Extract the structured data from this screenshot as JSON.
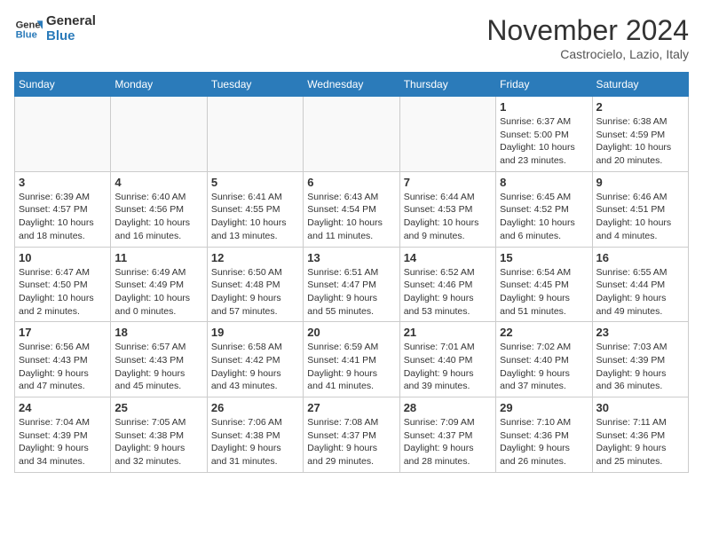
{
  "header": {
    "logo_line1": "General",
    "logo_line2": "Blue",
    "month": "November 2024",
    "location": "Castrocielo, Lazio, Italy"
  },
  "weekdays": [
    "Sunday",
    "Monday",
    "Tuesday",
    "Wednesday",
    "Thursday",
    "Friday",
    "Saturday"
  ],
  "weeks": [
    [
      {
        "day": "",
        "info": ""
      },
      {
        "day": "",
        "info": ""
      },
      {
        "day": "",
        "info": ""
      },
      {
        "day": "",
        "info": ""
      },
      {
        "day": "",
        "info": ""
      },
      {
        "day": "1",
        "info": "Sunrise: 6:37 AM\nSunset: 5:00 PM\nDaylight: 10 hours\nand 23 minutes."
      },
      {
        "day": "2",
        "info": "Sunrise: 6:38 AM\nSunset: 4:59 PM\nDaylight: 10 hours\nand 20 minutes."
      }
    ],
    [
      {
        "day": "3",
        "info": "Sunrise: 6:39 AM\nSunset: 4:57 PM\nDaylight: 10 hours\nand 18 minutes."
      },
      {
        "day": "4",
        "info": "Sunrise: 6:40 AM\nSunset: 4:56 PM\nDaylight: 10 hours\nand 16 minutes."
      },
      {
        "day": "5",
        "info": "Sunrise: 6:41 AM\nSunset: 4:55 PM\nDaylight: 10 hours\nand 13 minutes."
      },
      {
        "day": "6",
        "info": "Sunrise: 6:43 AM\nSunset: 4:54 PM\nDaylight: 10 hours\nand 11 minutes."
      },
      {
        "day": "7",
        "info": "Sunrise: 6:44 AM\nSunset: 4:53 PM\nDaylight: 10 hours\nand 9 minutes."
      },
      {
        "day": "8",
        "info": "Sunrise: 6:45 AM\nSunset: 4:52 PM\nDaylight: 10 hours\nand 6 minutes."
      },
      {
        "day": "9",
        "info": "Sunrise: 6:46 AM\nSunset: 4:51 PM\nDaylight: 10 hours\nand 4 minutes."
      }
    ],
    [
      {
        "day": "10",
        "info": "Sunrise: 6:47 AM\nSunset: 4:50 PM\nDaylight: 10 hours\nand 2 minutes."
      },
      {
        "day": "11",
        "info": "Sunrise: 6:49 AM\nSunset: 4:49 PM\nDaylight: 10 hours\nand 0 minutes."
      },
      {
        "day": "12",
        "info": "Sunrise: 6:50 AM\nSunset: 4:48 PM\nDaylight: 9 hours\nand 57 minutes."
      },
      {
        "day": "13",
        "info": "Sunrise: 6:51 AM\nSunset: 4:47 PM\nDaylight: 9 hours\nand 55 minutes."
      },
      {
        "day": "14",
        "info": "Sunrise: 6:52 AM\nSunset: 4:46 PM\nDaylight: 9 hours\nand 53 minutes."
      },
      {
        "day": "15",
        "info": "Sunrise: 6:54 AM\nSunset: 4:45 PM\nDaylight: 9 hours\nand 51 minutes."
      },
      {
        "day": "16",
        "info": "Sunrise: 6:55 AM\nSunset: 4:44 PM\nDaylight: 9 hours\nand 49 minutes."
      }
    ],
    [
      {
        "day": "17",
        "info": "Sunrise: 6:56 AM\nSunset: 4:43 PM\nDaylight: 9 hours\nand 47 minutes."
      },
      {
        "day": "18",
        "info": "Sunrise: 6:57 AM\nSunset: 4:43 PM\nDaylight: 9 hours\nand 45 minutes."
      },
      {
        "day": "19",
        "info": "Sunrise: 6:58 AM\nSunset: 4:42 PM\nDaylight: 9 hours\nand 43 minutes."
      },
      {
        "day": "20",
        "info": "Sunrise: 6:59 AM\nSunset: 4:41 PM\nDaylight: 9 hours\nand 41 minutes."
      },
      {
        "day": "21",
        "info": "Sunrise: 7:01 AM\nSunset: 4:40 PM\nDaylight: 9 hours\nand 39 minutes."
      },
      {
        "day": "22",
        "info": "Sunrise: 7:02 AM\nSunset: 4:40 PM\nDaylight: 9 hours\nand 37 minutes."
      },
      {
        "day": "23",
        "info": "Sunrise: 7:03 AM\nSunset: 4:39 PM\nDaylight: 9 hours\nand 36 minutes."
      }
    ],
    [
      {
        "day": "24",
        "info": "Sunrise: 7:04 AM\nSunset: 4:39 PM\nDaylight: 9 hours\nand 34 minutes."
      },
      {
        "day": "25",
        "info": "Sunrise: 7:05 AM\nSunset: 4:38 PM\nDaylight: 9 hours\nand 32 minutes."
      },
      {
        "day": "26",
        "info": "Sunrise: 7:06 AM\nSunset: 4:38 PM\nDaylight: 9 hours\nand 31 minutes."
      },
      {
        "day": "27",
        "info": "Sunrise: 7:08 AM\nSunset: 4:37 PM\nDaylight: 9 hours\nand 29 minutes."
      },
      {
        "day": "28",
        "info": "Sunrise: 7:09 AM\nSunset: 4:37 PM\nDaylight: 9 hours\nand 28 minutes."
      },
      {
        "day": "29",
        "info": "Sunrise: 7:10 AM\nSunset: 4:36 PM\nDaylight: 9 hours\nand 26 minutes."
      },
      {
        "day": "30",
        "info": "Sunrise: 7:11 AM\nSunset: 4:36 PM\nDaylight: 9 hours\nand 25 minutes."
      }
    ]
  ]
}
